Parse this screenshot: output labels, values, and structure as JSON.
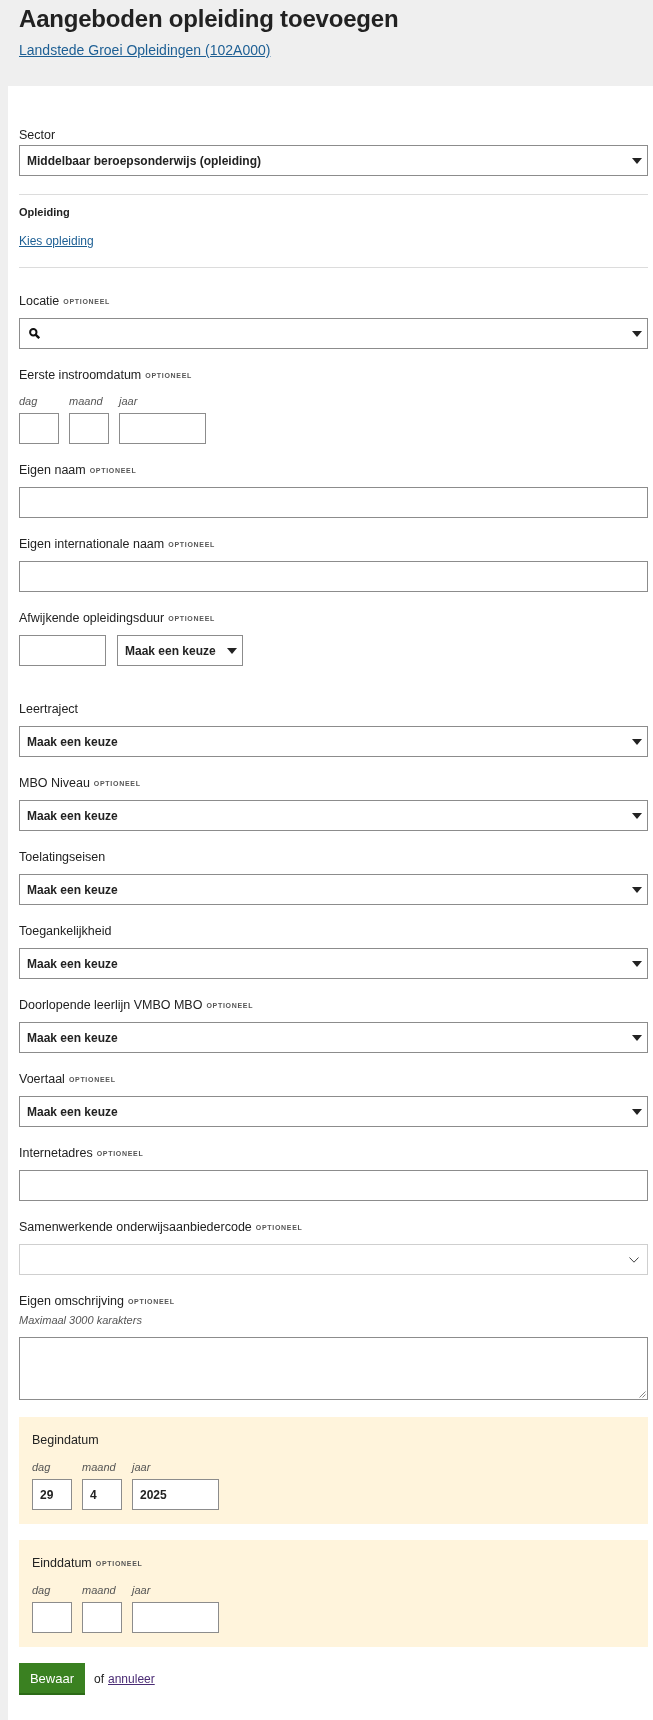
{
  "header": {
    "title": "Aangeboden opleiding toevoegen",
    "organisation_link": "Landstede Groei Opleidingen (102A000)"
  },
  "form": {
    "fields": [
      {
        "kind": "select",
        "label": "Sector",
        "value": "Middelbaar beroepsonderwijs (opleiding)"
      },
      {
        "kind": "divider"
      },
      {
        "kind": "choice",
        "label": "Opleiding",
        "link": "Kies opleiding"
      },
      {
        "kind": "divider"
      },
      {
        "kind": "search",
        "label": "Locatie",
        "tag": "OPTIONEEL"
      },
      {
        "kind": "date",
        "label": "Eerste instroomdatum",
        "tag": "OPTIONEEL",
        "parts": [
          {
            "label": "dag"
          },
          {
            "label": "maand"
          },
          {
            "label": "jaar"
          }
        ]
      },
      {
        "kind": "text",
        "label": "Eigen naam",
        "tag": "OPTIONEEL"
      },
      {
        "kind": "text",
        "label": "Eigen internationale naam",
        "tag": "OPTIONEEL"
      },
      {
        "kind": "duration",
        "label": "Afwijkende opleidingsduur",
        "tag": "OPTIONEEL",
        "value": "Maak een keuze"
      },
      {
        "kind": "select",
        "label": "Leertraject",
        "value": "Maak een keuze"
      },
      {
        "kind": "select",
        "label": "MBO Niveau",
        "tag": "OPTIONEEL",
        "value": "Maak een keuze"
      },
      {
        "kind": "select",
        "label": "Toelatingseisen",
        "value": "Maak een keuze"
      },
      {
        "kind": "select",
        "label": "Toegankelijkheid",
        "value": "Maak een keuze"
      },
      {
        "kind": "select",
        "label": "Doorlopende leerlijn VMBO MBO",
        "tag": "OPTIONEEL",
        "value": "Maak een keuze"
      },
      {
        "kind": "select",
        "label": "Voertaal",
        "tag": "OPTIONEEL",
        "value": "Maak een keuze"
      },
      {
        "kind": "text",
        "label": "Internetadres",
        "tag": "OPTIONEEL"
      },
      {
        "kind": "combobox",
        "label": "Samenwerkende onderwijsaanbiedercode",
        "tag": "OPTIONEEL"
      },
      {
        "kind": "textarea",
        "label": "Eigen omschrijving",
        "tag": "OPTIONEEL",
        "hint": "Maximaal 3000 karakters"
      }
    ],
    "date_panels": [
      {
        "label": "Begindatum",
        "parts": [
          {
            "label": "dag",
            "value": "29"
          },
          {
            "label": "maand",
            "value": "4"
          },
          {
            "label": "jaar",
            "value": "2025"
          }
        ]
      },
      {
        "label": "Einddatum",
        "tag": "OPTIONEEL",
        "parts": [
          {
            "label": "dag"
          },
          {
            "label": "maand"
          },
          {
            "label": "jaar"
          }
        ]
      }
    ],
    "actions": {
      "save_button": "Bewaar",
      "separator": "of",
      "cancel_link": "annuleer"
    }
  }
}
